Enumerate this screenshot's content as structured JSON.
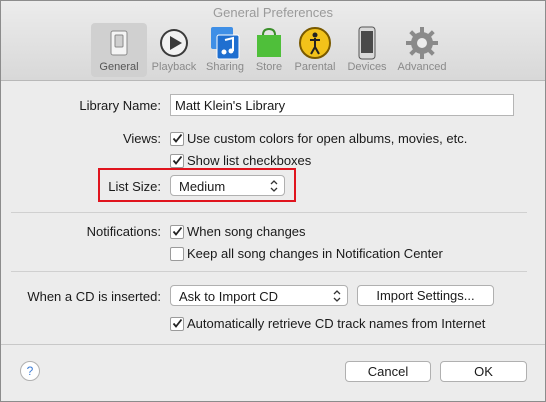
{
  "window": {
    "title": "General Preferences"
  },
  "toolbar": {
    "items": [
      {
        "label": "General",
        "icon": "general-switch-icon",
        "selected": true
      },
      {
        "label": "Playback",
        "icon": "play-icon"
      },
      {
        "label": "Sharing",
        "icon": "music-sharing-icon"
      },
      {
        "label": "Store",
        "icon": "shopping-bag-icon"
      },
      {
        "label": "Parental",
        "icon": "parental-icon"
      },
      {
        "label": "Devices",
        "icon": "phone-icon"
      },
      {
        "label": "Advanced",
        "icon": "gear-icon"
      }
    ]
  },
  "library": {
    "label": "Library Name:",
    "value": "Matt Klein's Library"
  },
  "views": {
    "label": "Views:",
    "custom_colors": {
      "label": "Use custom colors for open albums, movies, etc.",
      "checked": true
    },
    "list_checkboxes": {
      "label": "Show list checkboxes",
      "checked": true
    }
  },
  "list_size": {
    "label": "List Size:",
    "value": "Medium"
  },
  "notifications": {
    "label": "Notifications:",
    "song_changes": {
      "label": "When song changes",
      "checked": true
    },
    "keep_all": {
      "label": "Keep all song changes in Notification Center",
      "checked": false
    }
  },
  "cd": {
    "label": "When a CD is inserted:",
    "action": "Ask to Import CD",
    "import_settings": "Import Settings...",
    "auto_retrieve": {
      "label": "Automatically retrieve CD track names from Internet",
      "checked": true
    }
  },
  "footer": {
    "help": "?",
    "cancel": "Cancel",
    "ok": "OK"
  },
  "colors": {
    "highlight_box": "#e0141e",
    "accent": "#3b7bd5"
  }
}
